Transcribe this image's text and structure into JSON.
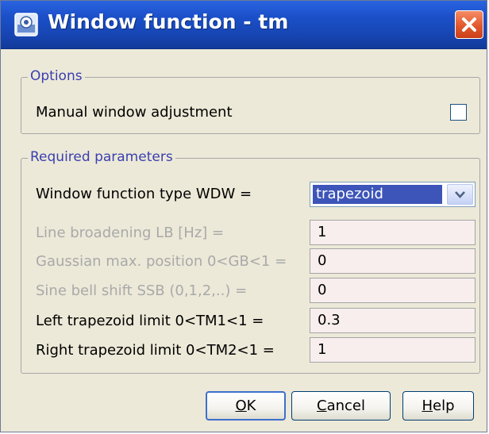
{
  "window": {
    "title": "Window function - tm",
    "app_icon": "app-icon",
    "close_icon": "close-icon"
  },
  "options": {
    "legend": "Options",
    "manual_label": "Manual window adjustment",
    "manual_checked": false
  },
  "params": {
    "legend": "Required parameters",
    "wdw": {
      "label": "Window function type WDW =",
      "value": "trapezoid"
    },
    "lb": {
      "label": "Line broadening LB [Hz] =",
      "value": "1",
      "enabled": false
    },
    "gb": {
      "label": "Gaussian max. position 0<GB<1 =",
      "value": "0",
      "enabled": false
    },
    "ssb": {
      "label": "Sine bell shift SSB (0,1,2,..) =",
      "value": "0",
      "enabled": false
    },
    "tm1": {
      "label": "Left trapezoid limit 0<TM1<1 =",
      "value": "0.3",
      "enabled": true
    },
    "tm2": {
      "label": "Right trapezoid limit 0<TM2<1 =",
      "value": "1",
      "enabled": true
    }
  },
  "buttons": {
    "ok": {
      "mnemonic": "O",
      "rest": "K"
    },
    "cancel": {
      "mnemonic": "C",
      "rest": "ancel"
    },
    "help": {
      "mnemonic": "H",
      "rest": "elp"
    }
  },
  "colors": {
    "title_bar": "#1b4fc8",
    "legend_text": "#3a3fb0",
    "field_background": "#f8eeee",
    "selection": "#3d55b8"
  }
}
